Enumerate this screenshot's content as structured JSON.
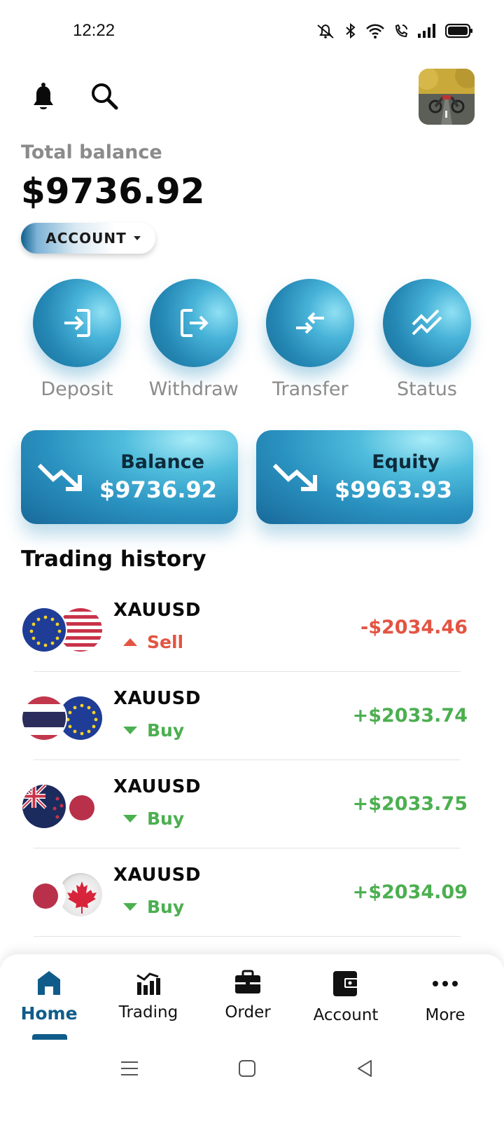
{
  "status_bar": {
    "time": "12:22"
  },
  "header": {
    "notification_icon": "bell-icon",
    "search_icon": "search-icon",
    "avatar_alt": "profile-avatar"
  },
  "balance": {
    "label": "Total balance",
    "value": "$9736.92",
    "account_selector": "ACCOUNT"
  },
  "actions": [
    {
      "label": "Deposit",
      "icon": "login-arrow-icon"
    },
    {
      "label": "Withdraw",
      "icon": "logout-arrow-icon"
    },
    {
      "label": "Transfer",
      "icon": "transfer-arrows-icon"
    },
    {
      "label": "Status",
      "icon": "trend-lines-icon"
    }
  ],
  "cards": [
    {
      "label": "Balance",
      "value": "$9736.92",
      "icon": "trending-down-icon"
    },
    {
      "label": "Equity",
      "value": "$9963.93",
      "icon": "trending-down-icon"
    }
  ],
  "history": {
    "title": "Trading history",
    "rows": [
      {
        "symbol": "XAUUSD",
        "side": "Sell",
        "amount": "-$2034.46",
        "flags": [
          "eu",
          "us"
        ]
      },
      {
        "symbol": "XAUUSD",
        "side": "Buy",
        "amount": "+$2033.74",
        "flags": [
          "th",
          "eu"
        ]
      },
      {
        "symbol": "XAUUSD",
        "side": "Buy",
        "amount": "+$2033.75",
        "flags": [
          "nz",
          "jp"
        ]
      },
      {
        "symbol": "XAUUSD",
        "side": "Buy",
        "amount": "+$2034.09",
        "flags": [
          "jp",
          "ca"
        ]
      }
    ]
  },
  "colors": {
    "sell": "#e35442",
    "buy": "#4caf50",
    "accent": "#0f5c8a"
  },
  "bottom_nav": [
    {
      "label": "Home",
      "icon": "home-icon",
      "active": true
    },
    {
      "label": "Trading",
      "icon": "chart-icon",
      "active": false
    },
    {
      "label": "Order",
      "icon": "briefcase-icon",
      "active": false
    },
    {
      "label": "Account",
      "icon": "wallet-icon",
      "active": false
    },
    {
      "label": "More",
      "icon": "more-dots-icon",
      "active": false
    }
  ]
}
